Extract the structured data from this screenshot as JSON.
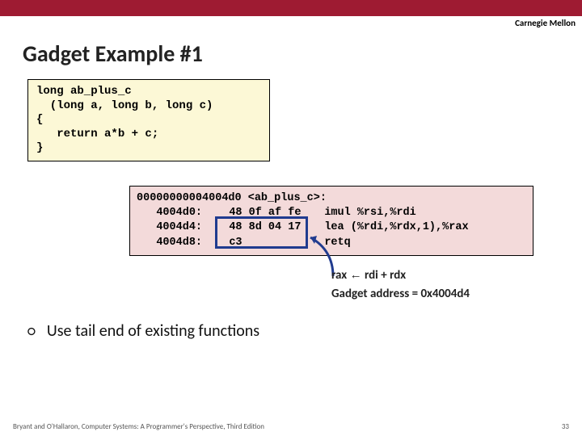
{
  "brand": "Carnegie Mellon",
  "title": "Gadget Example #1",
  "code_c": "long ab_plus_c\n  (long a, long b, long c)\n{\n   return a*b + c;\n}",
  "asm": {
    "header": {
      "addr": "00000000004004d0",
      "sym": "<ab_plus_c>:"
    },
    "rows": [
      {
        "addr": "4004d0:",
        "bytes": "48 0f af fe",
        "instr": "imul %rsi,%rdi"
      },
      {
        "addr": "4004d4:",
        "bytes": "48 8d 04 17",
        "instr": "lea (%rdi,%rdx,1),%rax"
      },
      {
        "addr": "4004d8:",
        "bytes": "c3",
        "instr": "retq"
      }
    ]
  },
  "annotation": {
    "line1_pre": "rax ",
    "line1_arrow": "←",
    "line1_post": " rdi + rdx",
    "line2": "Gadget address = 0x4004d4"
  },
  "bullet": "Use tail end of existing functions",
  "footer_left": "Bryant and O'Hallaron, Computer Systems: A Programmer's Perspective, Third Edition",
  "footer_right": "33"
}
